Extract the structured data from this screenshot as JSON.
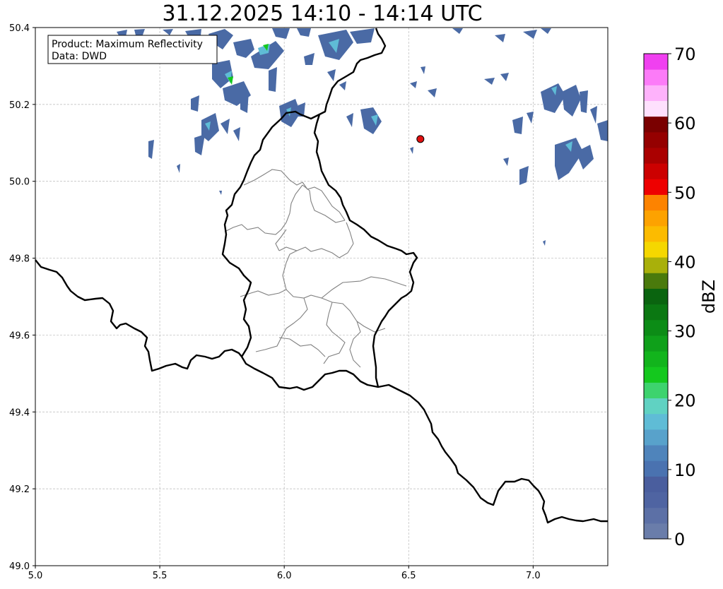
{
  "title": "31.12.2025 14:10 - 14:14 UTC",
  "info_box": {
    "line1": "Product: Maximum Reflectivity",
    "line2": "Data: DWD"
  },
  "axes": {
    "x_ticks": [
      "5.0",
      "5.5",
      "6.0",
      "6.5",
      "7.0"
    ],
    "y_ticks": [
      "49.0",
      "49.2",
      "49.4",
      "49.6",
      "49.8",
      "50.0",
      "50.2",
      "50.4"
    ],
    "lon_range": [
      5.0,
      7.3
    ],
    "lat_range": [
      49.0,
      50.4
    ],
    "grid": true
  },
  "marker": {
    "lon": 6.547,
    "lat": 50.11,
    "color": "#e01010"
  },
  "colorbar": {
    "unit": "dBZ",
    "tick_labels": [
      "0",
      "10",
      "20",
      "30",
      "40",
      "50",
      "60",
      "70"
    ],
    "colors": [
      "#6a7daa",
      "#5c70a6",
      "#4f64a2",
      "#4a5e9e",
      "#4a72b0",
      "#4f84bb",
      "#58a2cb",
      "#5fbcd6",
      "#60d2c2",
      "#3dd36e",
      "#14c81e",
      "#12b41c",
      "#0fa01a",
      "#0c8c16",
      "#0b7812",
      "#0a640f",
      "#4a7a0c",
      "#a9b00a",
      "#f5d700",
      "#fcbb00",
      "#fda200",
      "#fd8300",
      "#ee0000",
      "#cc0000",
      "#aa0000",
      "#950000",
      "#7a0000",
      "#fee0fd",
      "#feb2fb",
      "#fc7bf8",
      "#f040f0"
    ]
  },
  "layers": {
    "borders": "country boundaries",
    "districts": "cantonal boundaries",
    "radar": "reflectivity echoes"
  }
}
